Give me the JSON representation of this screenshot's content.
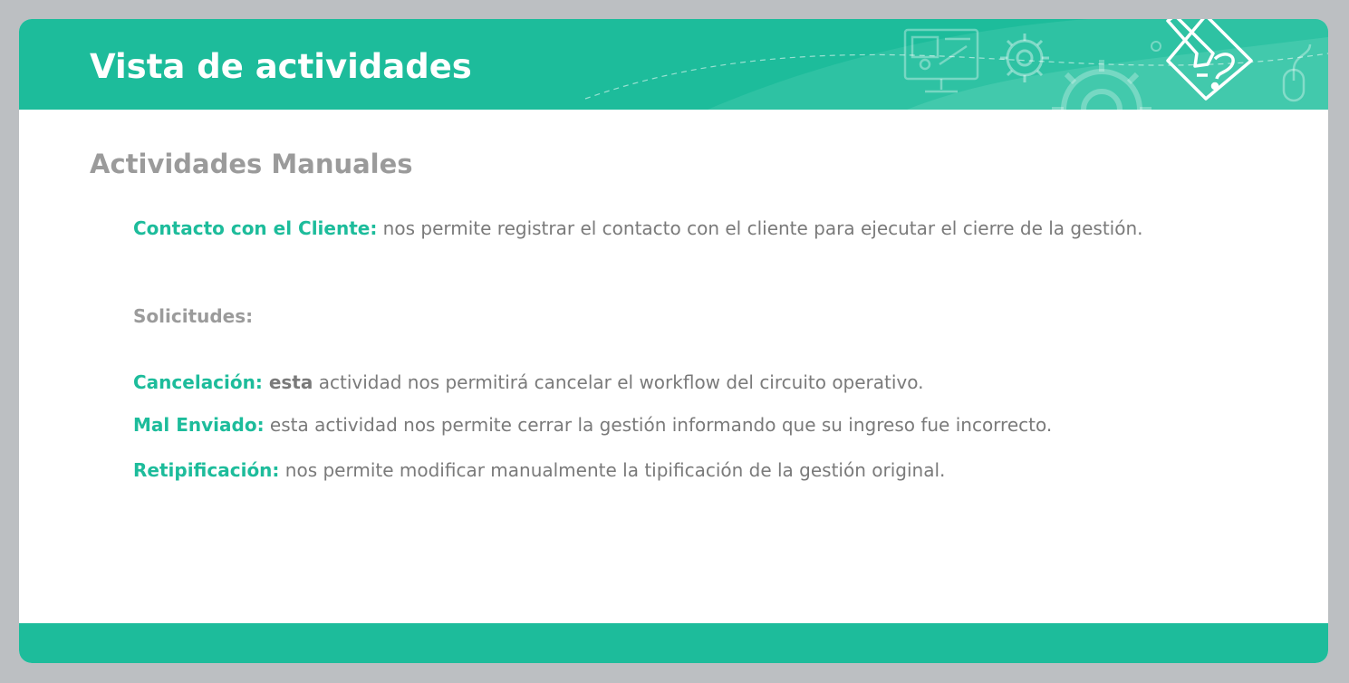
{
  "header": {
    "title": "Vista de actividades"
  },
  "section": {
    "title": "Actividades Manuales"
  },
  "items": {
    "contacto": {
      "term": "Contacto con el Cliente:",
      "text": " nos permite registrar el contacto con el cliente para ejecutar el cierre de la gestión."
    },
    "solicitudes": {
      "label": "Solicitudes:"
    },
    "cancelacion": {
      "term": "Cancelación:",
      "bold": " esta",
      "text": " actividad nos permitirá cancelar el workflow del circuito operativo."
    },
    "mal_enviado": {
      "term": "Mal Enviado:",
      "text": " esta actividad nos permite cerrar la gestión informando que su ingreso fue incorrecto."
    },
    "retipificacion": {
      "term": "Retipificación:",
      "text": " nos permite modificar manualmente la tipificación de la gestión original."
    }
  },
  "icons": [
    "monitor-presentation-icon",
    "gear-icon",
    "large-gear-icon",
    "pencil-document-icon",
    "mouse-icon"
  ],
  "colors": {
    "accent": "#1dbc9b",
    "heading_gray": "#9b9b9b",
    "body_gray": "#7a7a7a",
    "background": "#bcbfc2"
  }
}
